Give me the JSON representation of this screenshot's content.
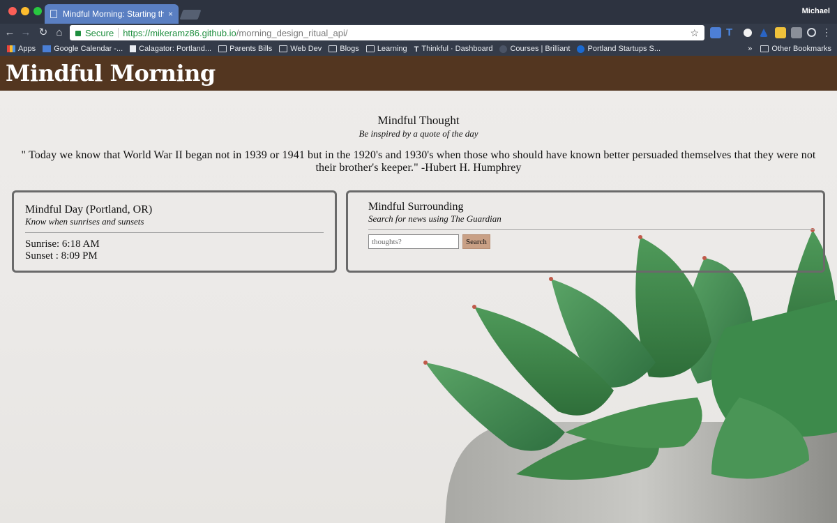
{
  "browser": {
    "tab_title": "Mindful Morning: Starting the d",
    "tab_close": "×",
    "profile_name": "Michael",
    "secure_label": "Secure",
    "url_host": "https://mikeramz86.github.io",
    "url_path": "/morning_design_ritual_api/",
    "bookmarks": [
      {
        "label": "Apps",
        "icon": "apps-icon"
      },
      {
        "label": "Google Calendar -...",
        "icon": "calendar-icon"
      },
      {
        "label": "Calagator: Portland...",
        "icon": "page-icon"
      },
      {
        "label": "Parents Bills",
        "icon": "folder-icon"
      },
      {
        "label": "Web Dev",
        "icon": "folder-icon"
      },
      {
        "label": "Blogs",
        "icon": "folder-icon"
      },
      {
        "label": "Learning",
        "icon": "folder-icon"
      },
      {
        "label": "Thinkful · Dashboard",
        "icon": "thinkful-icon"
      },
      {
        "label": "Courses | Brilliant",
        "icon": "brilliant-icon"
      },
      {
        "label": "Portland Startups S...",
        "icon": "s-icon"
      }
    ],
    "overflow_chevron": "»",
    "other_bookmarks": "Other Bookmarks"
  },
  "site": {
    "title": "Mindful Morning"
  },
  "thought": {
    "heading": "Mindful Thought",
    "subheading": "Be inspired by a quote of the day",
    "quote": "\" Today we know that World War II began not in 1939 or 1941 but in the 1920's and 1930's when those who should have known better persuaded themselves that they were not their brother's keeper.\" -Hubert H. Humphrey"
  },
  "day": {
    "heading": "Mindful Day (Portland, OR)",
    "subheading": "Know when sunrises and sunsets",
    "sunrise": "Sunrise: 6:18 AM",
    "sunset": "Sunset : 8:09 PM"
  },
  "surrounding": {
    "heading": "Mindful Surrounding",
    "subheading": "Search for news using The Guardian",
    "search_placeholder": "thoughts?",
    "search_button": "Search"
  },
  "colors": {
    "header_bg": "#533620",
    "tab_active": "#5a7fc2",
    "search_button_bg": "#c9a085",
    "leaf_green": "#3f8a4a"
  }
}
